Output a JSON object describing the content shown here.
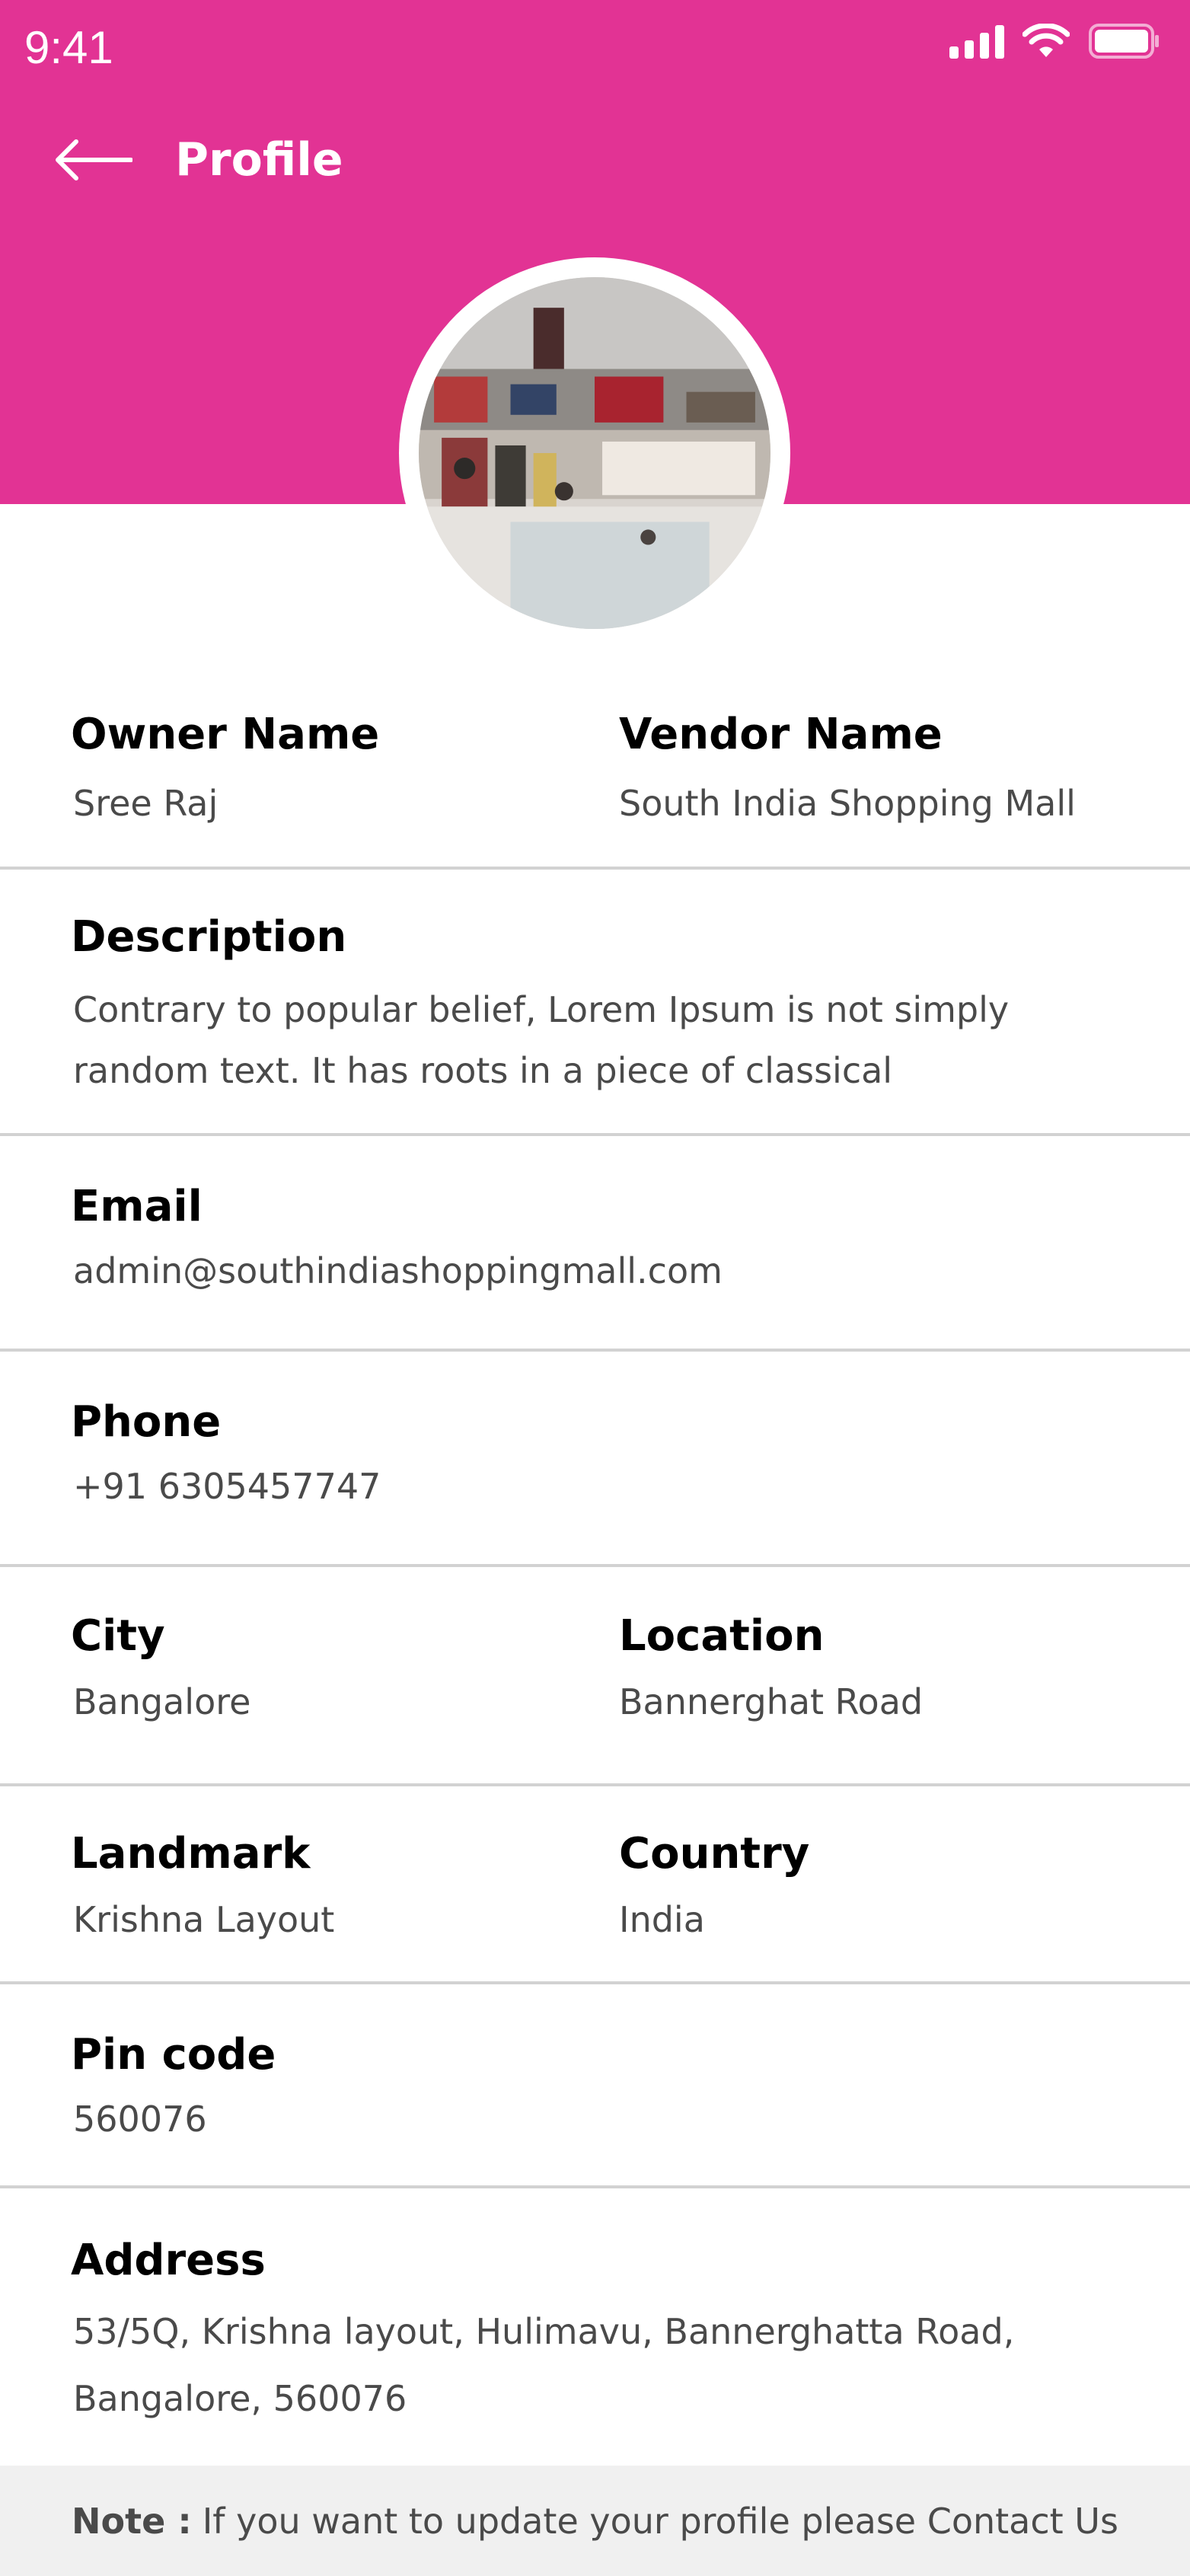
{
  "status_bar": {
    "time": "9:41",
    "icons": [
      "signal-icon",
      "wifi-icon",
      "battery-icon"
    ]
  },
  "header": {
    "title": "Profile",
    "back_icon": "arrow-left-icon",
    "background": "#e23394"
  },
  "profile": {
    "owner_name_label": "Owner Name",
    "owner_name": "Sree Raj",
    "vendor_name_label": "Vendor Name",
    "vendor_name": "South India Shopping Mall",
    "description_label": "Description",
    "description": "Contrary to popular belief, Lorem Ipsum is not simply random text. It has roots in a piece of classical",
    "email_label": "Email",
    "email": "admin@southindiashoppingmall.com",
    "phone_label": "Phone",
    "phone": "+91 6305457747",
    "city_label": "City",
    "city": "Bangalore",
    "location_label": "Location",
    "location": "Bannerghat Road",
    "landmark_label": "Landmark",
    "landmark": "Krishna Layout",
    "country_label": "Country",
    "country": "India",
    "pincode_label": "Pin code",
    "pincode": "560076",
    "address_label": "Address",
    "address": "53/5Q, Krishna layout, Hulimavu, Bannerghatta Road, Bangalore, 560076"
  },
  "note": {
    "prefix": "Note :",
    "text": "If you want to update your profile please Contact Us"
  }
}
